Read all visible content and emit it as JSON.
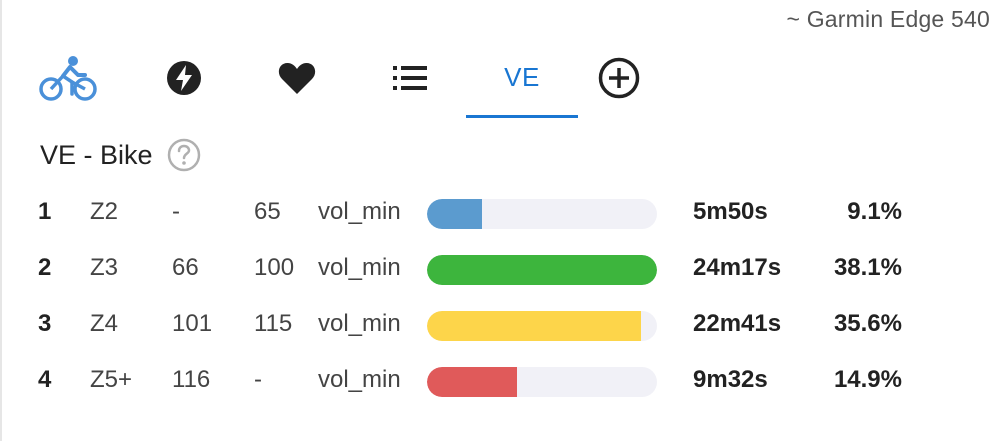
{
  "header": {
    "device_label": "~ Garmin Edge 540"
  },
  "tabs": [
    {
      "id": "bike",
      "icon": "bike-icon"
    },
    {
      "id": "power",
      "icon": "lightning-icon"
    },
    {
      "id": "heart",
      "icon": "heart-icon"
    },
    {
      "id": "list",
      "icon": "list-icon"
    },
    {
      "id": "ve",
      "label": "VE",
      "active": true
    },
    {
      "id": "add",
      "icon": "add-circle-icon"
    }
  ],
  "section": {
    "title": "VE - Bike",
    "help_icon": "help-circle-icon"
  },
  "zones": [
    {
      "num": "1",
      "zone": "Z2",
      "min": "-",
      "max": "65",
      "unit": "vol_min",
      "fraction": 0.24,
      "color": "#5b9bcf",
      "time": "5m50s",
      "pct": "9.1%"
    },
    {
      "num": "2",
      "zone": "Z3",
      "min": "66",
      "max": "100",
      "unit": "vol_min",
      "fraction": 1.0,
      "color": "#3db53d",
      "time": "24m17s",
      "pct": "38.1%"
    },
    {
      "num": "3",
      "zone": "Z4",
      "min": "101",
      "max": "115",
      "unit": "vol_min",
      "fraction": 0.93,
      "color": "#fdd54a",
      "time": "22m41s",
      "pct": "35.6%"
    },
    {
      "num": "4",
      "zone": "Z5+",
      "min": "116",
      "max": "-",
      "unit": "vol_min",
      "fraction": 0.39,
      "color": "#e05a5a",
      "time": "9m32s",
      "pct": "14.9%"
    }
  ],
  "colors": {
    "accent": "#1976d2",
    "icon_dark": "#222222",
    "bike_icon": "#4a90d9"
  }
}
